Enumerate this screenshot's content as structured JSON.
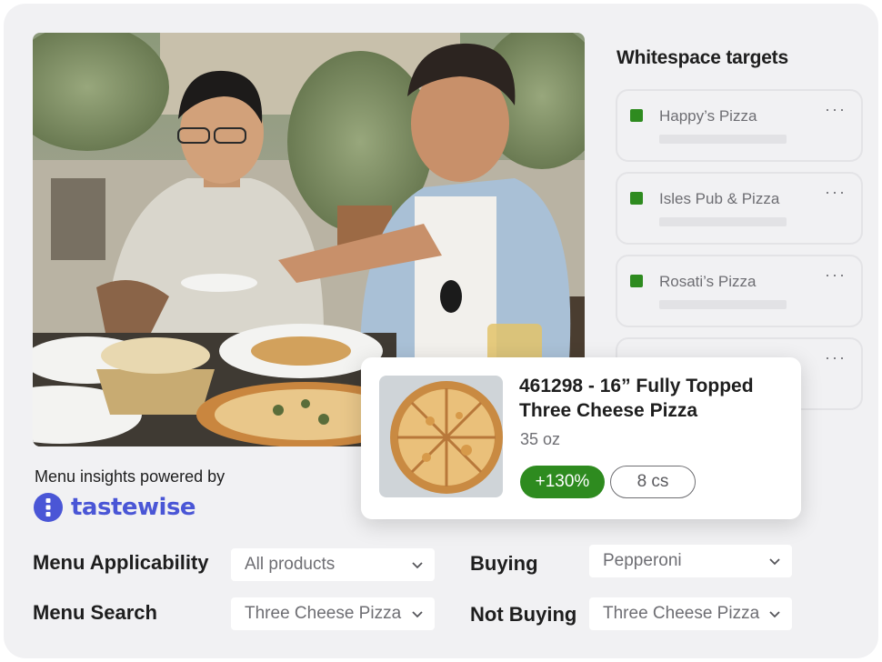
{
  "whitespace": {
    "title": "Whitespace targets",
    "accent": "#2e8b1f",
    "more_label": "···",
    "items": [
      {
        "name": "Happy’s Pizza"
      },
      {
        "name": "Isles Pub & Pizza"
      },
      {
        "name": "Rosati’s Pizza"
      },
      {
        "name": ""
      }
    ]
  },
  "product": {
    "title": "461298 - 16” Fully Topped Three Cheese Pizza",
    "weight": "35 oz",
    "change": "+130%",
    "cases": "8 cs",
    "change_color": "#2e8b1f"
  },
  "branding": {
    "powered_by": "Menu insights powered by",
    "name": "tastewise",
    "brand_color": "#4a56d6"
  },
  "filters": {
    "menu_applicability": {
      "label": "Menu Applicability",
      "value": "All products"
    },
    "menu_search": {
      "label": "Menu Search",
      "value": "Three Cheese Pizza"
    },
    "buying": {
      "label": "Buying",
      "value": "Pepperoni"
    },
    "not_buying": {
      "label": "Not Buying",
      "value": "Three Cheese Pizza"
    }
  },
  "icons": {
    "chevron": "chevron-down-icon",
    "status": "green-square-icon",
    "more": "more-dots-icon",
    "logo": "tastewise-logo"
  }
}
